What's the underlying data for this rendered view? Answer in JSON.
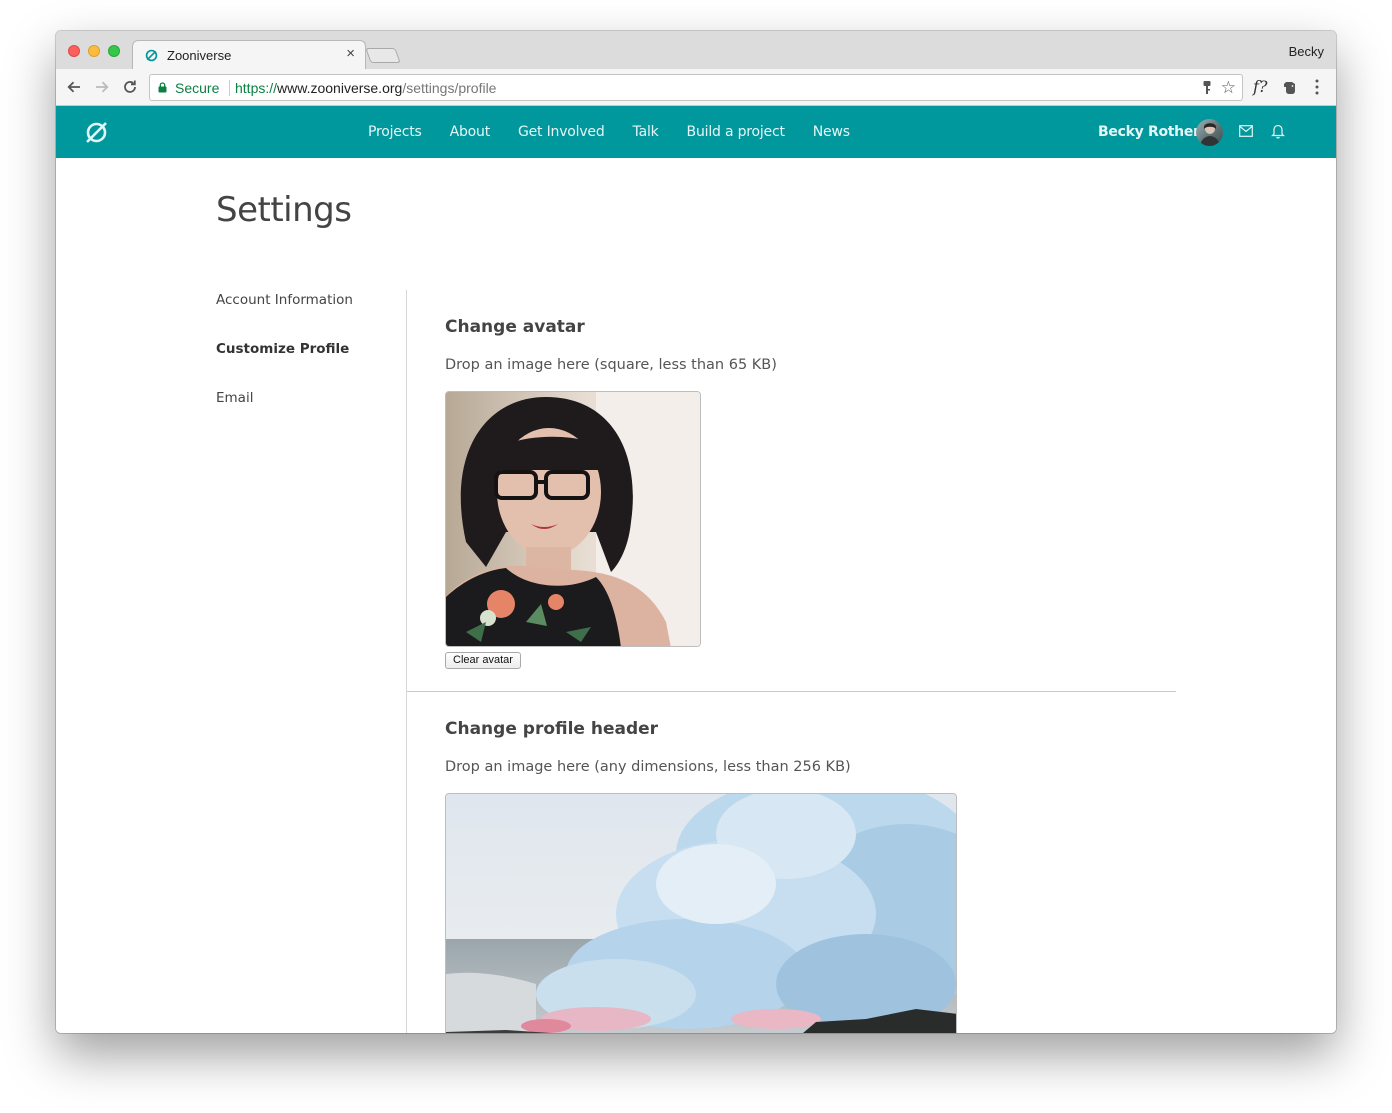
{
  "browser": {
    "tab_title": "Zooniverse",
    "tab_close": "×",
    "profile_name": "Becky",
    "secure_label": "Secure",
    "url_scheme": "https://",
    "url_host": "www.zooniverse.org",
    "url_path": "/settings/profile",
    "extension_label": "f?"
  },
  "header": {
    "nav": [
      "Projects",
      "About",
      "Get Involved",
      "Talk",
      "Build a project",
      "News"
    ],
    "user_name": "Becky Rother",
    "brand_color": "#00979d"
  },
  "page": {
    "title": "Settings",
    "side_nav": [
      {
        "label": "Account Information",
        "active": false
      },
      {
        "label": "Customize Profile",
        "active": true
      },
      {
        "label": "Email",
        "active": false
      }
    ],
    "avatar_section": {
      "title": "Change avatar",
      "hint": "Drop an image here (square, less than 65 KB)",
      "clear_button": "Clear avatar"
    },
    "header_section": {
      "title": "Change profile header",
      "hint": "Drop an image here (any dimensions, less than 256 KB)"
    }
  }
}
